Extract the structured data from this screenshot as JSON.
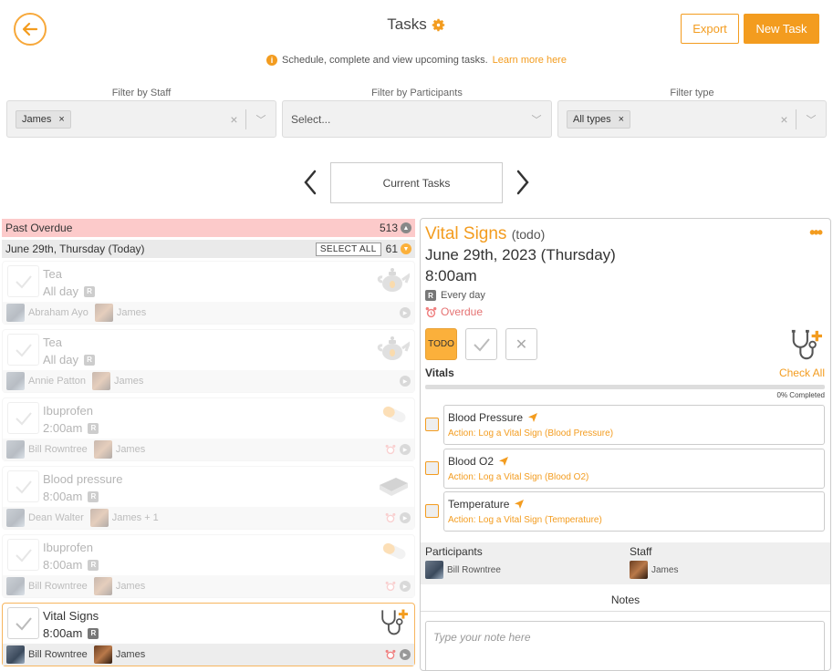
{
  "header": {
    "title": "Tasks",
    "export_label": "Export",
    "new_task_label": "New Task",
    "info_text": "Schedule, complete and view upcoming tasks.",
    "info_link": "Learn more here"
  },
  "filters": {
    "staff": {
      "label": "Filter by Staff",
      "chip": "James"
    },
    "participants": {
      "label": "Filter by Participants",
      "placeholder": "Select..."
    },
    "type": {
      "label": "Filter type",
      "chip": "All types"
    }
  },
  "navigator": {
    "current": "Current Tasks"
  },
  "list": {
    "past_overdue": {
      "label": "Past Overdue",
      "count": "513"
    },
    "today": {
      "label": "June 29th, Thursday (Today)",
      "select_all": "SELECT ALL",
      "count": "61"
    },
    "tasks": [
      {
        "title": "Tea",
        "time": "All day",
        "participant": "Abraham Ayo",
        "staff": "James",
        "icon": "teapot-icon",
        "alarm": false
      },
      {
        "title": "Tea",
        "time": "All day",
        "participant": "Annie Patton",
        "staff": "James",
        "icon": "teapot-icon",
        "alarm": false
      },
      {
        "title": "Ibuprofen",
        "time": "2:00am",
        "participant": "Bill Rowntree",
        "staff": "James",
        "icon": "pill-icon",
        "alarm": true
      },
      {
        "title": "Blood pressure",
        "time": "8:00am",
        "participant": "Dean Walter",
        "staff": "James + 1",
        "icon": "book-icon",
        "alarm": true
      },
      {
        "title": "Ibuprofen",
        "time": "8:00am",
        "participant": "Bill Rowntree",
        "staff": "James",
        "icon": "pill-icon",
        "alarm": true
      },
      {
        "title": "Vital Signs",
        "time": "8:00am",
        "participant": "Bill Rowntree",
        "staff": "James",
        "icon": "stethoscope-icon",
        "alarm": true
      }
    ]
  },
  "detail": {
    "title": "Vital Signs",
    "status_text": "(todo)",
    "date": "June 29th, 2023 (Thursday)",
    "time": "8:00am",
    "recurrence": "Every day",
    "overdue": "Overdue",
    "todo_label": "TODO",
    "vitals_label": "Vitals",
    "check_all": "Check All",
    "progress_fraction": 0,
    "progress_text": "0% Completed",
    "vitals": [
      {
        "name": "Blood Pressure",
        "action": "Action: Log a Vital Sign (Blood Pressure)"
      },
      {
        "name": "Blood O2",
        "action": "Action: Log a Vital Sign (Blood O2)"
      },
      {
        "name": "Temperature",
        "action": "Action: Log a Vital Sign (Temperature)"
      }
    ],
    "participants_label": "Participants",
    "participant": "Bill Rowntree",
    "staff_label": "Staff",
    "staff": "James",
    "notes_label": "Notes",
    "notes_placeholder": "Type your note here"
  },
  "colors": {
    "accent": "#f39c1f",
    "overdue_bg": "#fccaca",
    "overdue_text": "#e57373"
  }
}
